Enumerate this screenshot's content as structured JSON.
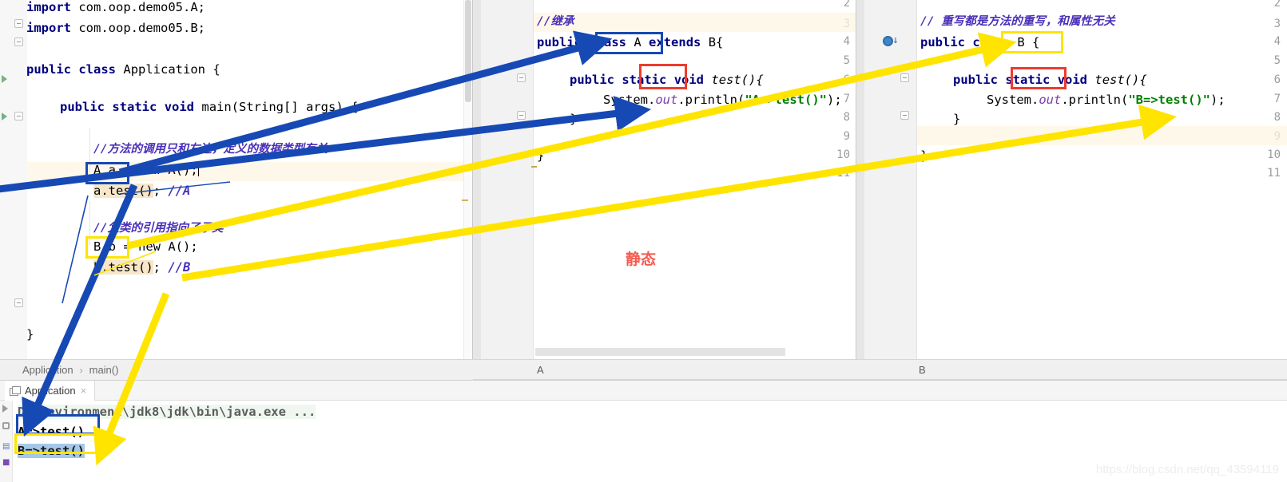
{
  "panes": {
    "main": {
      "tab_label": "",
      "breadcrumb": {
        "class": "Application",
        "separator": "›",
        "method": "main()"
      },
      "lines": [
        "import com.oop.demo05.A;",
        "import com.oop.demo05.B;",
        "",
        "public class Application {",
        "",
        "    public static void main(String[] args) {",
        "",
        "        //方法的调用只和左边，定义的数据类型有关",
        "        A a = new A();",
        "        a.test(); //A",
        "",
        "        //父类的引用指向了子类",
        "        B b = new A();",
        "        b.test(); //B",
        "",
        "",
        "}"
      ],
      "tokens": {
        "import": "import",
        "import_a": "com.oop.demo05.A;",
        "import_b": "com.oop.demo05.B;",
        "public": "public",
        "class": "class",
        "static": "static",
        "void": "void",
        "new": "new",
        "application": "Application {",
        "main_sig": "main(String[] args) {",
        "comment1": "//方法的调用只和左边，定义的数据类型有关",
        "decl_a": "A a",
        "decl_a_rest": " = new A();",
        "call_a": "a.test()",
        "call_a_rest": "; ",
        "call_a_cmt": "//A",
        "comment2": "//父类的引用指向了子类",
        "decl_b": "B b",
        "decl_b_rest": " = new A();",
        "call_b": "b.test()",
        "call_b_rest": "; ",
        "call_b_cmt": "//B",
        "close_brace": "}"
      }
    },
    "a": {
      "tab_label": "A",
      "line_numbers": [
        "2",
        "3",
        "4",
        "5",
        "6",
        "7",
        "8",
        "9",
        "10",
        "11"
      ],
      "tokens": {
        "comment": "//继承",
        "public": "public",
        "class": "class",
        "class_name_a": "A",
        "extends": "extends",
        "super_b": "B{",
        "static": "static",
        "void": "void",
        "test_sig": "test(){",
        "system": "System.",
        "out": "out",
        "println": ".println(",
        "str_a": "\"A=>test()\"",
        "println_end": ");",
        "close_inner": "}",
        "close_outer": "}"
      }
    },
    "b": {
      "tab_label": "B",
      "line_numbers": [
        "2",
        "3",
        "4",
        "5",
        "6",
        "7",
        "8",
        "9",
        "10",
        "11"
      ],
      "tokens": {
        "comment": "// 重写都是方法的重写，和属性无关",
        "public": "public",
        "class": "class",
        "class_name_b": "B",
        "brace": "{",
        "static": "static",
        "void": "void",
        "test_sig": "test(){",
        "system": "System.",
        "out": "out",
        "println": ".println(",
        "str_b": "\"B=>test()\"",
        "println_end": ");",
        "close_inner": "}",
        "close_outer": "}"
      }
    }
  },
  "console": {
    "tab_label": "Application",
    "tab_close": "×",
    "lines": [
      {
        "text": "D:\\Environment\\jdk8\\jdk\\bin\\java.exe ...",
        "style": "cmd"
      },
      {
        "text": "A=>test()",
        "style": "out"
      },
      {
        "text": "B=>test()",
        "style": "selected"
      }
    ]
  },
  "annotations": {
    "static_label": "静态",
    "colors": {
      "blue": "#1749b5",
      "yellow": "#ffe400",
      "red": "#f03a2e",
      "static_text": "#f45b4f"
    }
  },
  "watermark": "https://blog.csdn.net/qq_43594119"
}
